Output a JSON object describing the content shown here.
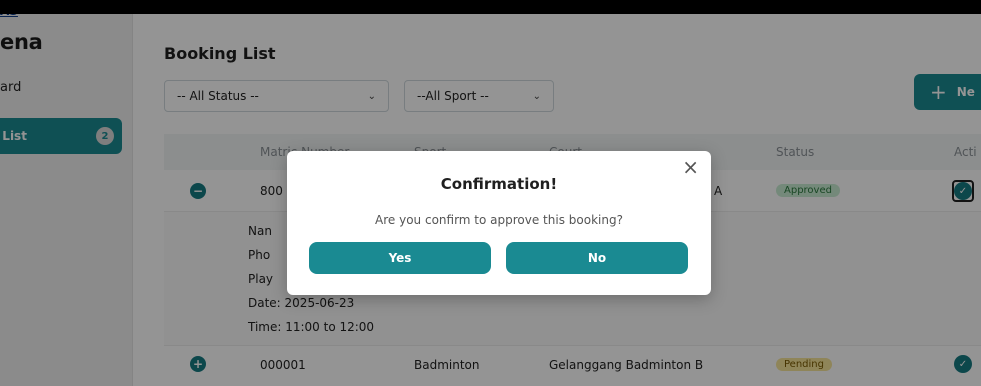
{
  "sidebar": {
    "brand_top": "AS",
    "brand": "ena",
    "items": [
      {
        "label": "ard"
      },
      {
        "label": "j List",
        "badge": "2"
      }
    ]
  },
  "main": {
    "title": "Booking List",
    "filters": {
      "status": "-- All Status --",
      "sport": "--All Sport --"
    },
    "new_button": "Ne",
    "table": {
      "headers": {
        "matric": "Matric Number",
        "sport": "Sport",
        "court": "Court",
        "status": "Status",
        "action": "Acti"
      },
      "rows": [
        {
          "expand": "−",
          "matric": "800",
          "sport": "",
          "court": "A",
          "status": "Approved"
        },
        {
          "expand": "+",
          "matric": "000001",
          "sport": "Badminton",
          "court": "Gelanggang Badminton B",
          "status": "Pending"
        }
      ],
      "details": {
        "name": "Nan",
        "phone": "Pho",
        "players": "Play",
        "date": "Date: 2025-06-23",
        "time": "Time: 11:00 to 12:00"
      }
    }
  },
  "modal": {
    "title": "Confirmation!",
    "message": "Are you confirm to approve this booking?",
    "yes": "Yes",
    "no": "No",
    "close": "×"
  },
  "colors": {
    "accent": "#1a8a92",
    "approved": "#c9ecd3",
    "pending": "#f7e59a"
  }
}
